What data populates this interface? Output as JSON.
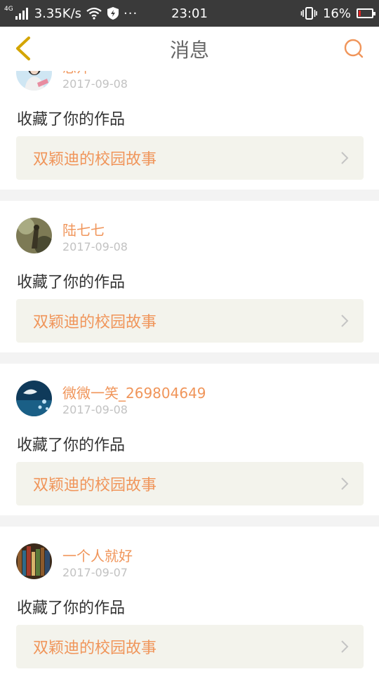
{
  "status_bar": {
    "network_type": "4G",
    "speed": "3.35K/s",
    "more": "···",
    "time": "23:01",
    "battery_percent": "16%",
    "battery_level": 0.16
  },
  "nav": {
    "title": "消息",
    "back_icon": "chevron-left-icon",
    "search_icon": "search-icon"
  },
  "colors": {
    "accent": "#f0955a",
    "back_arrow": "#d4a500",
    "card_link_bg": "#f3f3ec"
  },
  "messages": [
    {
      "user": "思萍",
      "date": "2017-09-08",
      "action": "收藏了你的作品",
      "work": "双颖迪的校园故事"
    },
    {
      "user": "陆七七",
      "date": "2017-09-08",
      "action": "收藏了你的作品",
      "work": "双颖迪的校园故事"
    },
    {
      "user": "微微一笑_269804649",
      "date": "2017-09-08",
      "action": "收藏了你的作品",
      "work": "双颖迪的校园故事"
    },
    {
      "user": "一个人就好",
      "date": "2017-09-07",
      "action": "收藏了你的作品",
      "work": "双颖迪的校园故事"
    }
  ]
}
